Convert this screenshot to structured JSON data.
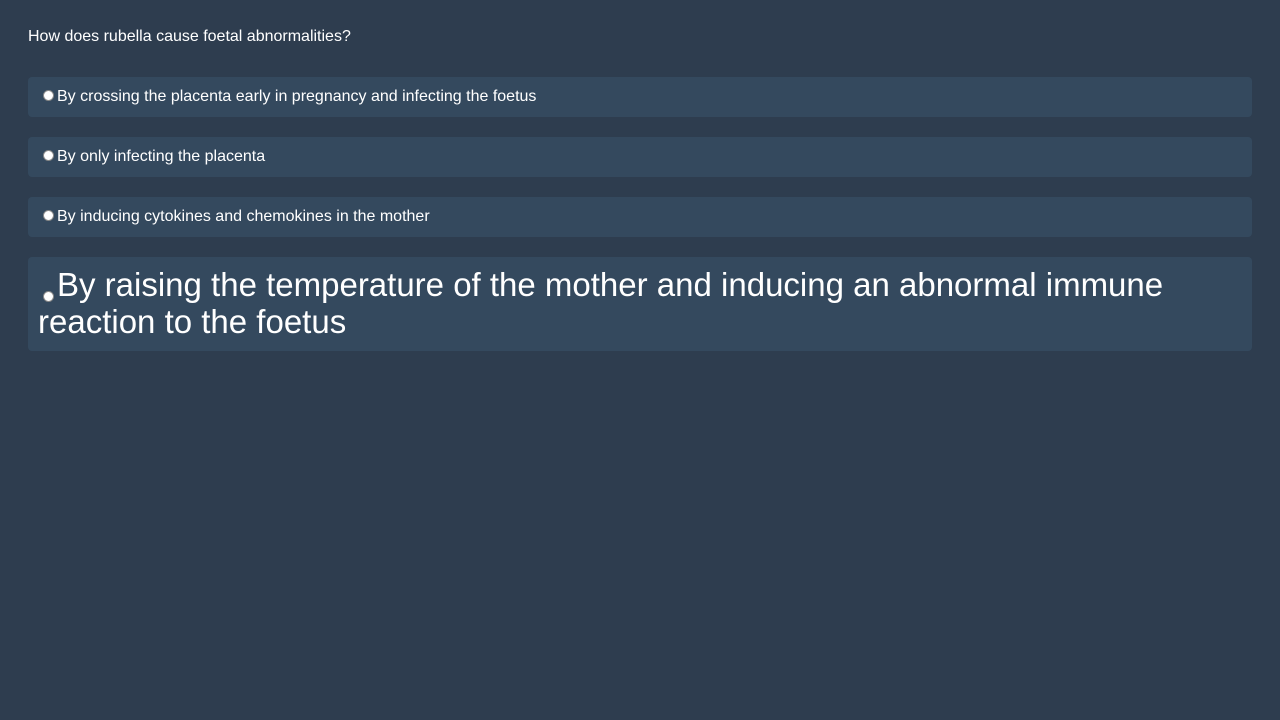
{
  "quiz": {
    "question": "How does rubella cause foetal abnormalities?",
    "options": [
      {
        "label": "By crossing the placenta early in pregnancy and infecting the foetus",
        "selected": false
      },
      {
        "label": "By only infecting the placenta",
        "selected": false
      },
      {
        "label": "By inducing cytokines and chemokines in the mother",
        "selected": false
      },
      {
        "label": "By raising the temperature of the mother and inducing an abnormal immune reaction to the foetus",
        "selected": false
      }
    ]
  },
  "colors": {
    "background": "#2e3d4f",
    "option_background": "#34495e",
    "text": "#ffffff"
  }
}
